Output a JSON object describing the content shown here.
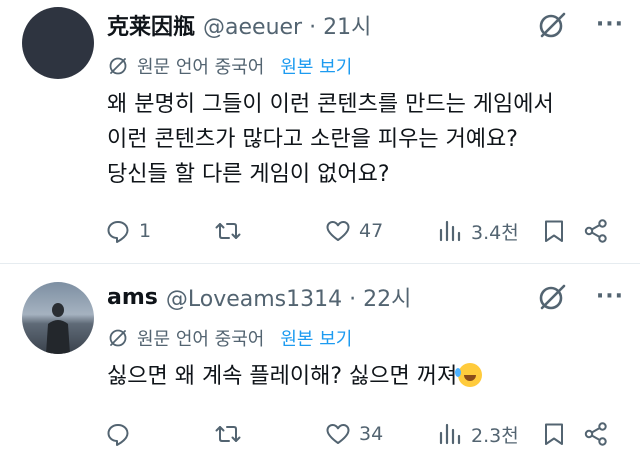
{
  "tweets": [
    {
      "name": "克莱因瓶",
      "handle": "@aeeuer · 21시",
      "translated_label": "원문 언어 중국어",
      "show_original": "원본 보기",
      "lines": [
        "왜 분명히 그들이 이런 콘텐츠를 만드는 게임에서",
        "이런 콘텐츠가 많다고 소란을 피우는 거예요?",
        "당신들 할 다른 게임이 없어요?"
      ],
      "replies": "1",
      "retweets": "",
      "likes": "47",
      "views": "3.4천"
    },
    {
      "name": "ams",
      "handle": "@Loveams1314 · 22시",
      "translated_label": "원문 언어 중국어",
      "show_original": "원본 보기",
      "lines": [
        "싫으면 왜 계속 플레이해? 싫으면 꺼져"
      ],
      "emoji": "rolling-on-floor-laughing-emoji",
      "replies": "",
      "retweets": "",
      "likes": "34",
      "views": "2.3천"
    }
  ],
  "colors": {
    "text": "#0f1419",
    "muted": "#536471",
    "accent": "#1d9bf0",
    "divider": "#e6ecf0"
  }
}
